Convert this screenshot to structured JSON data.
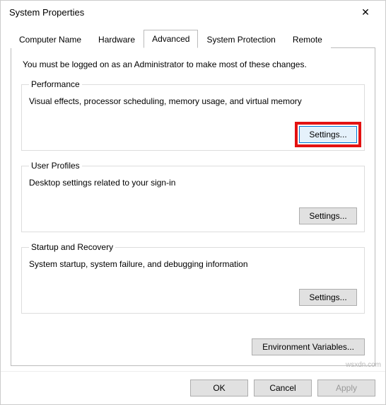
{
  "window": {
    "title": "System Properties"
  },
  "tabs": {
    "computer_name": "Computer Name",
    "hardware": "Hardware",
    "advanced": "Advanced",
    "system_protection": "System Protection",
    "remote": "Remote"
  },
  "advanced_panel": {
    "intro": "You must be logged on as an Administrator to make most of these changes.",
    "performance": {
      "legend": "Performance",
      "desc": "Visual effects, processor scheduling, memory usage, and virtual memory",
      "button": "Settings..."
    },
    "user_profiles": {
      "legend": "User Profiles",
      "desc": "Desktop settings related to your sign-in",
      "button": "Settings..."
    },
    "startup": {
      "legend": "Startup and Recovery",
      "desc": "System startup, system failure, and debugging information",
      "button": "Settings..."
    },
    "env_vars_button": "Environment Variables..."
  },
  "footer": {
    "ok": "OK",
    "cancel": "Cancel",
    "apply": "Apply"
  },
  "watermark": "wsxdn.com"
}
